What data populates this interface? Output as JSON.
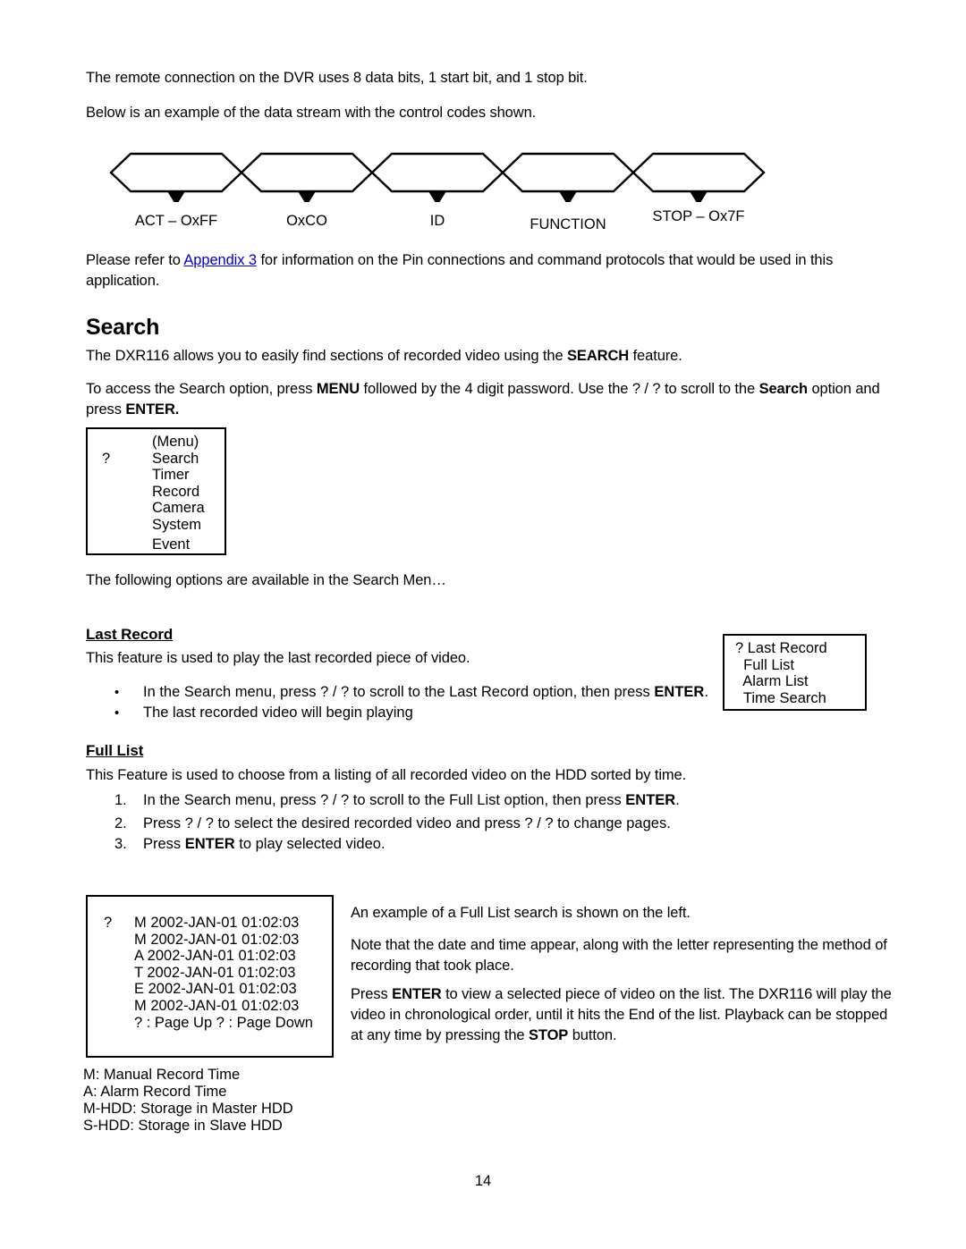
{
  "document": {
    "page_number": "14"
  },
  "intro": {
    "line1": "The remote connection on the DVR uses 8 data bits, 1 start bit, and 1 stop bit.",
    "line2": "Below is an example of the data stream with the control codes shown."
  },
  "data_stream_diagram": {
    "cells": [
      {
        "label": "ACT – OxFF"
      },
      {
        "label": "OxCO"
      },
      {
        "label": "ID"
      },
      {
        "label": "FUNCTION"
      },
      {
        "label": "STOP – Ox7F"
      }
    ]
  },
  "appendix_para": {
    "before_link": "Please refer to ",
    "link_text": "Appendix 3",
    "after_link": " for information on the Pin connections and command protocols that would be used in this",
    "line2": "application."
  },
  "search_section": {
    "heading": "Search",
    "para1_a": "The DXR116 allows you to easily find sections of recorded video using the ",
    "para1_b": "SEARCH",
    "para1_c": " feature.",
    "para2_a": "To access the Search option, press ",
    "para2_b": "MENU",
    "para2_c": " followed by the 4 digit password. Use the ?  / ?  to scroll to the ",
    "para2_d": "Search",
    "para2_e": " option and",
    "para2_f": "press ",
    "para2_g": "ENTER.",
    "options_intro": "The following options are available in the Search Men…"
  },
  "main_menu_box": {
    "marker": "?",
    "lines": [
      "(Menu)",
      "Search",
      "Timer",
      "Record",
      "Camera",
      "System",
      "Event"
    ]
  },
  "last_record": {
    "heading": "Last Record",
    "para": "This feature is used to play the last recorded piece of video.",
    "bullets": [
      {
        "dot": "•",
        "text_a": "In the Search menu, press ?  / ?  to scroll to the Last Record option, then press ",
        "text_b": "ENTER",
        "text_c": "."
      },
      {
        "dot": "•",
        "text_a": "The last recorded video will begin playing",
        "text_b": "",
        "text_c": ""
      }
    ]
  },
  "search_menu_box": {
    "lines": [
      "? Last Record",
      "  Full List",
      "  Alarm List",
      "  Time Search"
    ]
  },
  "full_list": {
    "heading": "Full List",
    "para": "This Feature is used to choose from a listing of all recorded video on the HDD sorted by time.",
    "steps": [
      {
        "number": "1.",
        "text_a": "In the Search menu, press ?  / ?  to scroll to the Full List option, then press ",
        "text_b": "ENTER",
        "text_c": "."
      },
      {
        "number": "2.",
        "text_a": "Press ?  / ?  to select the desired recorded video and press ?  / ?  to change pages.",
        "text_b": "",
        "text_c": ""
      },
      {
        "number": "3.",
        "text_a": "Press ",
        "text_b": "ENTER",
        "text_c": " to play selected video."
      }
    ]
  },
  "full_list_box": {
    "marker": "?",
    "entries": [
      "M 2002-JAN-01 01:02:03",
      "M 2002-JAN-01 01:02:03",
      "A 2002-JAN-01 01:02:03",
      "T 2002-JAN-01 01:02:03",
      "E 2002-JAN-01 01:02:03",
      "M 2002-JAN-01 01:02:03"
    ],
    "footer": "? : Page Up ? : Page Down"
  },
  "full_list_notes": {
    "p1": "An example of a Full List search is shown on the left.",
    "p2_line1": "Note that the date and time appear, along with the letter representing the method of",
    "p2_line2": "recording that took place.",
    "p3_a": "Press ",
    "p3_b": "ENTER",
    "p3_c": " to view a selected piece of video on the list. The DXR116 will play the",
    "p3_line2": "video in chronological order, until it hits the End of the list. Playback can be stopped",
    "p3_line3_a": "at any time by pressing the ",
    "p3_line3_b": "STOP",
    "p3_line3_c": " button."
  },
  "record_legend": {
    "lines": [
      "M: Manual Record Time",
      "A: Alarm Record Time",
      "M-HDD: Storage in Master HDD",
      "S-HDD: Storage in Slave HDD"
    ]
  }
}
